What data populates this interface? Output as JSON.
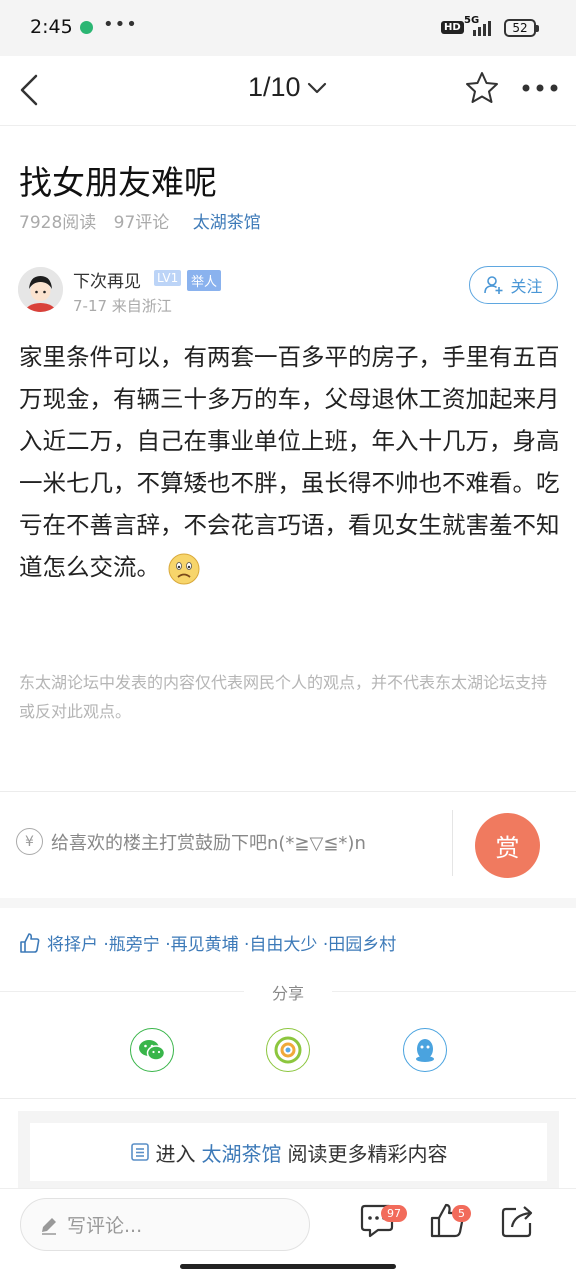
{
  "status": {
    "time": "2:45",
    "more": "•••",
    "hd": "HD",
    "net": "5G",
    "battery": "52"
  },
  "nav": {
    "page_indicator": "1/10"
  },
  "post": {
    "title": "找女朋友难呢",
    "reads": "7928阅读",
    "comments": "97评论",
    "forum": "太湖茶馆",
    "author": "下次再见",
    "level": "LV1",
    "role": "举人",
    "date_location": "7-17  来自浙江",
    "follow_label": "关注",
    "body": "家里条件可以，有两套一百多平的房子，手里有五百万现金，有辆三十多万的车，父母退休工资加起来月入近二万，自己在事业单位上班，年入十几万，身高一米七几，不算矮也不胖，虽长得不帅也不难看。吃亏在不善言辞，不会花言巧语，看见女生就害羞不知道怎么交流。",
    "disclaimer": "东太湖论坛中发表的内容仅代表网民个人的观点，并不代表东太湖论坛支持或反对此观点。"
  },
  "reward": {
    "yen": "¥",
    "prompt": "给喜欢的楼主打赏鼓励下吧n(*≧▽≦*)n",
    "button": "赏"
  },
  "likes": {
    "text": "将择户 ·瓶旁宁 ·再见黄埔 ·自由大少 ·田园乡村"
  },
  "share": {
    "title": "分享",
    "items": [
      "wechat-icon",
      "moments-icon",
      "qq-icon"
    ]
  },
  "enter": {
    "prefix": "进入",
    "forum": "太湖茶馆",
    "suffix": "阅读更多精彩内容"
  },
  "bottom": {
    "placeholder": "写评论...",
    "comment_count": "97",
    "like_count": "5"
  },
  "colors": {
    "accent": "#3d7ab8",
    "reward": "#f07a5f",
    "badge": "#f26b5b"
  }
}
